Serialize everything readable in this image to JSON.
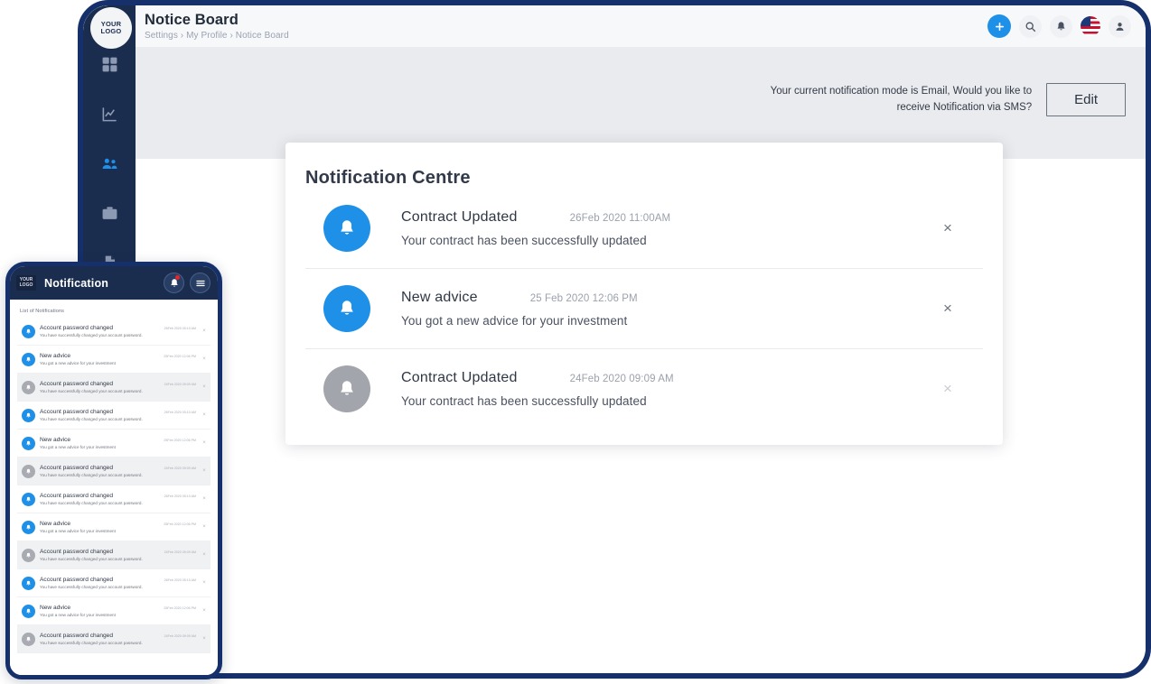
{
  "brand": {
    "logo_line1": "YOUR",
    "logo_line2": "LOGO",
    "accent_blue": "#1e90e8",
    "navy": "#1b2d4f",
    "frame_navy": "#15306b",
    "read_grey": "#a2a5ab"
  },
  "header": {
    "title": "Notice Board",
    "breadcrumb": "Settings › My Profile › Notice Board"
  },
  "topbar_actions": [
    {
      "name": "add-button",
      "icon": "plus-icon"
    },
    {
      "name": "search-button",
      "icon": "search-icon"
    },
    {
      "name": "notifications-button",
      "icon": "bell-icon"
    },
    {
      "name": "language-button",
      "icon": "us-flag-icon"
    },
    {
      "name": "account-button",
      "icon": "user-icon"
    }
  ],
  "sidebar": {
    "items": [
      {
        "name": "sidebar-item-dashboard",
        "icon": "grid-icon",
        "active": false
      },
      {
        "name": "sidebar-item-analytics",
        "icon": "chart-icon",
        "active": false
      },
      {
        "name": "sidebar-item-users",
        "icon": "people-icon",
        "active": true
      },
      {
        "name": "sidebar-item-portfolio",
        "icon": "briefcase-icon",
        "active": false
      },
      {
        "name": "sidebar-item-documents",
        "icon": "document-icon",
        "active": false
      },
      {
        "name": "sidebar-item-profile",
        "icon": "user-circle-icon",
        "active": false
      },
      {
        "name": "sidebar-item-logout",
        "icon": "power-icon",
        "active": false
      }
    ]
  },
  "banner": {
    "text": "Your current notification mode is Email, Would you like to receive Notification via SMS?",
    "edit_label": "Edit"
  },
  "notification_centre": {
    "title": "Notification Centre",
    "close_label": "×",
    "rows": [
      {
        "title": "Contract Updated",
        "time": "26Feb 2020 11:00AM",
        "desc": "Your contract has been successfully updated",
        "read": false
      },
      {
        "title": "New advice",
        "time": "25 Feb 2020 12:06 PM",
        "desc": "You got a new advice for your investment",
        "read": false
      },
      {
        "title": "Contract Updated",
        "time": "24Feb 2020 09:09 AM",
        "desc": "Your contract has been successfully updated",
        "read": true
      }
    ]
  },
  "phone": {
    "logo_line1": "YOUR",
    "logo_line2": "LOGO",
    "title": "Notification",
    "list_heading": "List of Notifications",
    "close_label": "×",
    "items": [
      {
        "title": "Account password changed",
        "time": "26Feb 2020 05:10 AM",
        "desc": "You have successfully changed your account password.",
        "read": false
      },
      {
        "title": "New advice",
        "time": "25Feb 2020 12:06 PM",
        "desc": "You got a new advice for your investment",
        "read": false
      },
      {
        "title": "Account password changed",
        "time": "24Feb 2020 09:09 AM",
        "desc": "You have successfully changed your account password.",
        "read": true
      },
      {
        "title": "Account password changed",
        "time": "26Feb 2020 05:10 AM",
        "desc": "You have successfully changed your account password.",
        "read": false
      },
      {
        "title": "New advice",
        "time": "25Feb 2020 12:06 PM",
        "desc": "You got a new advice for your investment",
        "read": false
      },
      {
        "title": "Account password changed",
        "time": "24Feb 2020 09:09 AM",
        "desc": "You have successfully changed your account password.",
        "read": true
      },
      {
        "title": "Account password changed",
        "time": "26Feb 2020 05:10 AM",
        "desc": "You have successfully changed your account password.",
        "read": false
      },
      {
        "title": "New advice",
        "time": "25Feb 2020 12:06 PM",
        "desc": "You got a new advice for your investment",
        "read": false
      },
      {
        "title": "Account password changed",
        "time": "24Feb 2020 09:09 AM",
        "desc": "You have successfully changed your account password.",
        "read": true
      },
      {
        "title": "Account password changed",
        "time": "26Feb 2020 05:10 AM",
        "desc": "You have successfully changed your account password.",
        "read": false
      },
      {
        "title": "New advice",
        "time": "25Feb 2020 12:06 PM",
        "desc": "You got a new advice for your investment",
        "read": false
      },
      {
        "title": "Account password changed",
        "time": "24Feb 2020 09:09 AM",
        "desc": "You have successfully changed your account password.",
        "read": true
      }
    ]
  }
}
